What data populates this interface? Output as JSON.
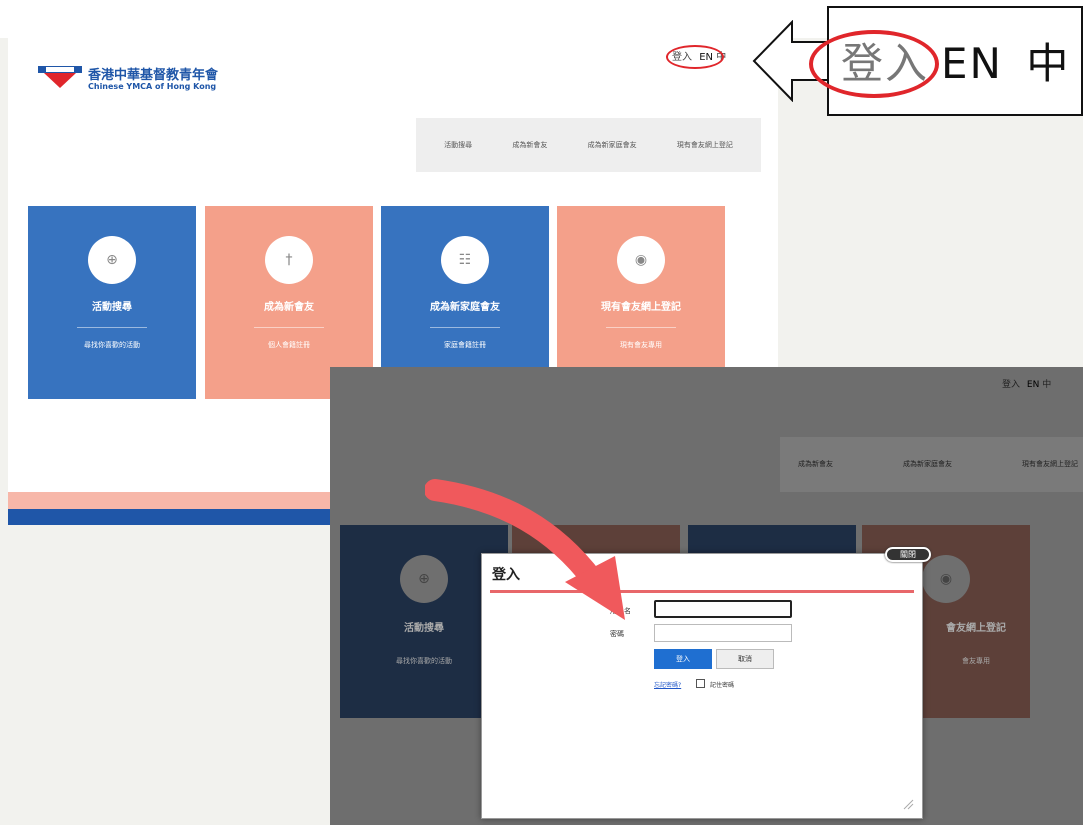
{
  "site": {
    "logo_cn": "香港中華基督教青年會",
    "logo_en": "Chinese YMCA of Hong Kong",
    "login_link": "登入",
    "lang_en": "EN",
    "lang_zh": "中",
    "nav": [
      "活動搜尋",
      "成為新會友",
      "成為新家庭會友",
      "現有會友網上登記"
    ],
    "tiles": [
      {
        "title": "活動搜尋",
        "subtitle": "尋找你喜歡的活動",
        "icon": "⊕",
        "color": "blue"
      },
      {
        "title": "成為新會友",
        "subtitle": "個人會籍註冊",
        "icon": "†",
        "color": "salmon"
      },
      {
        "title": "成為新家庭會友",
        "subtitle": "家庭會籍註冊",
        "icon": "☷",
        "color": "blue"
      },
      {
        "title": "現有會友網上登記",
        "subtitle": "現有會友專用",
        "icon": "◉",
        "color": "salmon"
      }
    ]
  },
  "zoom": {
    "login_text": "登入",
    "lang_en": "EN",
    "lang_zh": "中"
  },
  "page2": {
    "lang_login": "登入",
    "lang_en": "EN",
    "lang_zh": "中",
    "nav": [
      "成為新會友",
      "成為新家庭會友",
      "現有會友網上登記"
    ],
    "tiles": [
      {
        "title": "活動搜尋",
        "subtitle": "尋找你喜歡的活動",
        "icon": "⊕"
      },
      {
        "title": "",
        "subtitle": "",
        "icon": ""
      },
      {
        "title": "",
        "subtitle": "",
        "icon": ""
      },
      {
        "title": "會友網上登記",
        "subtitle": "會友專用",
        "icon": "◉"
      }
    ]
  },
  "dialog": {
    "title": "登入",
    "close_label": "關閉",
    "username_label": "用戶名",
    "password_label": "密碼",
    "username_value": "",
    "password_value": "",
    "login_button": "登入",
    "cancel_button": "取消",
    "forgot_link": "忘記密碼?",
    "remember_label": "記住密碼"
  },
  "colors": {
    "blue": "#3773bf",
    "salmon": "#f4a08a",
    "accent_red": "#e0262b",
    "brand_blue": "#1f56a8"
  }
}
